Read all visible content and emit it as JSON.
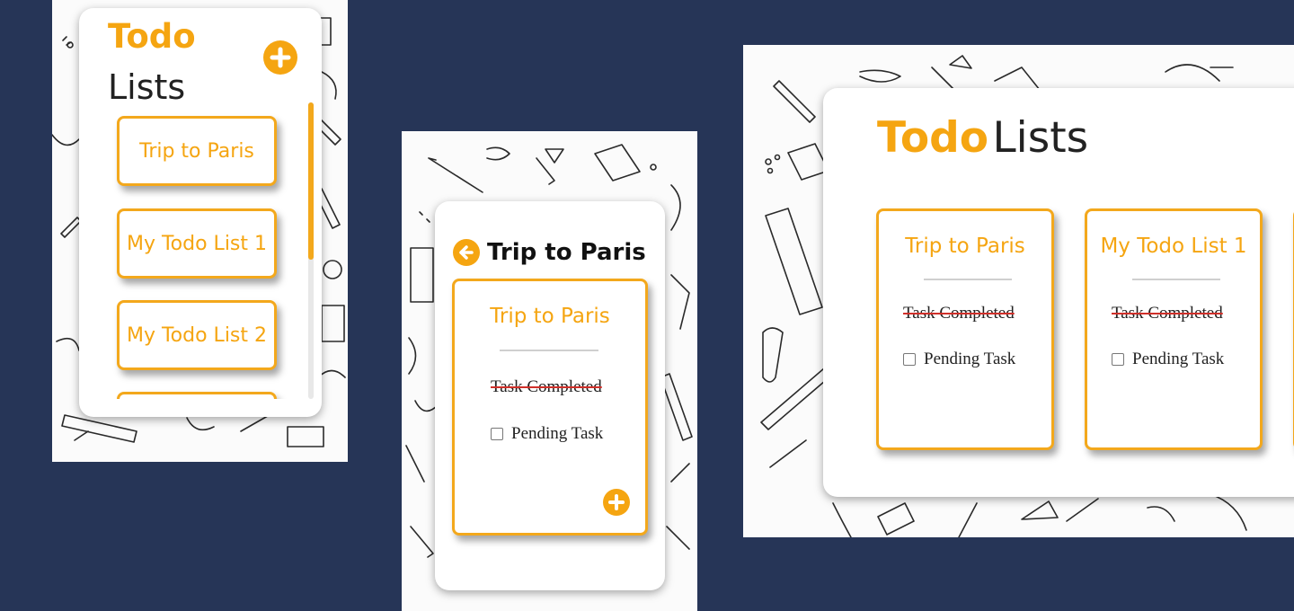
{
  "mobile_list": {
    "title_bold": "Todo",
    "title_light": "Lists",
    "lists": [
      "Trip to Paris",
      "My Todo List 1",
      "My Todo List 2"
    ]
  },
  "mobile_detail": {
    "title": "Trip to Paris",
    "card": {
      "name": "Trip to Paris",
      "completed_task": "Task Completed",
      "pending_task": "Pending Task"
    }
  },
  "desktop": {
    "title_bold": "Todo",
    "title_light": "Lists",
    "cards": [
      {
        "name": "Trip to Paris",
        "completed_task": "Task Completed",
        "pending_task": "Pending Task"
      },
      {
        "name": "My Todo List 1",
        "completed_task": "Task Completed",
        "pending_task": "Pending Task"
      }
    ]
  },
  "colors": {
    "accent": "#f5a511",
    "background": "#263557",
    "strike": "#d0302a"
  },
  "icons": [
    "plus-circle-icon",
    "back-arrow-icon"
  ]
}
